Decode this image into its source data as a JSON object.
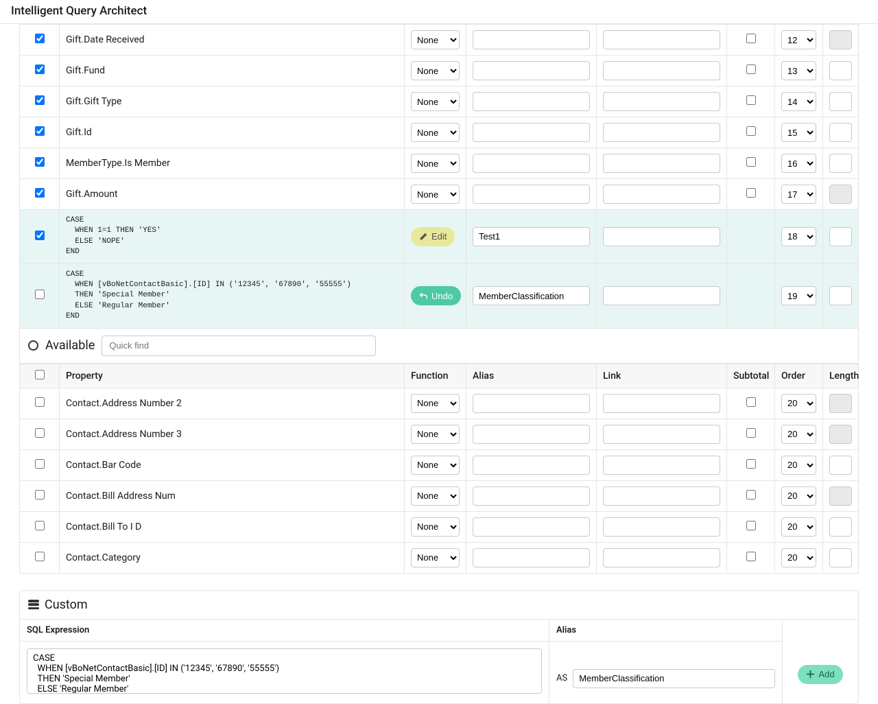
{
  "page_title": "Intelligent Query Architect",
  "func_none": "None",
  "selected_rows": [
    {
      "checked": true,
      "property": "Gift.Date Received",
      "func": "None",
      "alias": "",
      "link": "",
      "subtotal": false,
      "order": "12",
      "length_disabled": true,
      "highlight": false
    },
    {
      "checked": true,
      "property": "Gift.Fund",
      "func": "None",
      "alias": "",
      "link": "",
      "subtotal": false,
      "order": "13",
      "length_disabled": false,
      "highlight": false
    },
    {
      "checked": true,
      "property": "Gift.Gift Type",
      "func": "None",
      "alias": "",
      "link": "",
      "subtotal": false,
      "order": "14",
      "length_disabled": false,
      "highlight": false
    },
    {
      "checked": true,
      "property": "Gift.Id",
      "func": "None",
      "alias": "",
      "link": "",
      "subtotal": false,
      "order": "15",
      "length_disabled": false,
      "highlight": false
    },
    {
      "checked": true,
      "property": "MemberType.Is Member",
      "func": "None",
      "alias": "",
      "link": "",
      "subtotal": false,
      "order": "16",
      "length_disabled": false,
      "highlight": false
    },
    {
      "checked": true,
      "property": "Gift.Amount",
      "func": "None",
      "alias": "",
      "link": "",
      "subtotal": false,
      "order": "17",
      "length_disabled": true,
      "highlight": false
    }
  ],
  "custom_rows": [
    {
      "checked": true,
      "code": "CASE\n  WHEN 1=1 THEN 'YES'\n  ELSE 'NOPE'\nEND",
      "action": "edit",
      "alias": "Test1",
      "link": "",
      "order": "18",
      "length_disabled": false
    },
    {
      "checked": false,
      "code": "CASE\n  WHEN [vBoNetContactBasic].[ID] IN ('12345', '67890', '55555')\n  THEN 'Special Member'\n  ELSE 'Regular Member'\nEND",
      "action": "undo",
      "alias": "MemberClassification",
      "link": "",
      "order": "19",
      "length_disabled": false
    }
  ],
  "btn_edit": "Edit",
  "btn_undo": "Undo",
  "available": {
    "title": "Available",
    "quickfind_placeholder": "Quick find",
    "headers": {
      "property": "Property",
      "function": "Function",
      "alias": "Alias",
      "link": "Link",
      "subtotal": "Subtotal",
      "order": "Order",
      "length": "Length"
    }
  },
  "available_rows": [
    {
      "property": "Contact.Address Number 2",
      "order": "20",
      "length_disabled": true
    },
    {
      "property": "Contact.Address Number 3",
      "order": "20",
      "length_disabled": true
    },
    {
      "property": "Contact.Bar Code",
      "order": "20",
      "length_disabled": false
    },
    {
      "property": "Contact.Bill Address Num",
      "order": "20",
      "length_disabled": true
    },
    {
      "property": "Contact.Bill To I D",
      "order": "20",
      "length_disabled": false
    },
    {
      "property": "Contact.Category",
      "order": "20",
      "length_disabled": false
    }
  ],
  "custom_panel": {
    "title": "Custom",
    "sql_label": "SQL Expression",
    "alias_label": "Alias",
    "sql_value": "CASE\n  WHEN [vBoNetContactBasic].[ID] IN ('12345', '67890', '55555')\n  THEN 'Special Member'\n  ELSE 'Regular Member'\nEND",
    "as_label": "AS",
    "alias_value": "MemberClassification",
    "add_label": "Add"
  }
}
